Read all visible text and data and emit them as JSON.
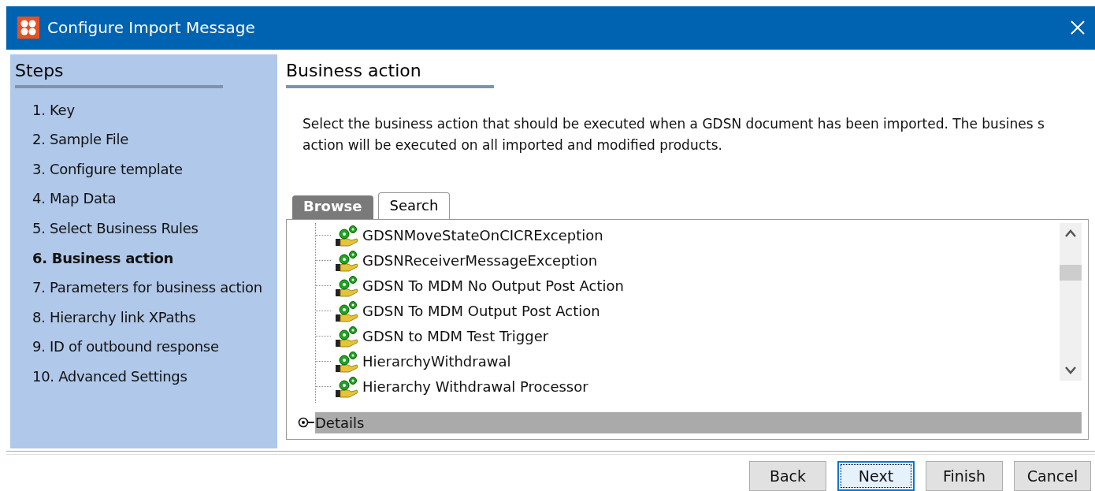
{
  "window": {
    "title": "Configure Import Message"
  },
  "steps": {
    "title": "Steps",
    "items": [
      {
        "label": "1. Key",
        "selected": false
      },
      {
        "label": "2. Sample File",
        "selected": false
      },
      {
        "label": "3. Configure template",
        "selected": false
      },
      {
        "label": "4. Map Data",
        "selected": false
      },
      {
        "label": "5. Select Business Rules",
        "selected": false
      },
      {
        "label": "6. Business action",
        "selected": true
      },
      {
        "label": "7. Parameters for business action",
        "selected": false
      },
      {
        "label": "8. Hierarchy link XPaths",
        "selected": false
      },
      {
        "label": "9. ID of outbound response",
        "selected": false
      },
      {
        "label": "10. Advanced Settings",
        "selected": false
      }
    ]
  },
  "content": {
    "title": "Business action",
    "description": "Select the business action that should be executed when a GDSN document has been imported. The busines s action will be executed on all imported and modified products.",
    "tabs": [
      {
        "label": "Browse",
        "selected": true
      },
      {
        "label": "Search",
        "selected": false
      }
    ],
    "tree_items": [
      "GDSNMoveStateOnCICRException",
      "GDSNReceiverMessageException",
      "GDSN To MDM No Output Post Action",
      "GDSN To MDM Output Post Action",
      "GDSN to MDM Test Trigger",
      "HierarchyWithdrawal",
      "Hierarchy Withdrawal Processor"
    ],
    "details": {
      "label": "Details",
      "expanded": false
    }
  },
  "buttons": [
    {
      "label": "Back",
      "focused": false
    },
    {
      "label": "Next",
      "focused": true
    },
    {
      "label": "Finish",
      "focused": false
    },
    {
      "label": "Cancel",
      "focused": false
    }
  ]
}
